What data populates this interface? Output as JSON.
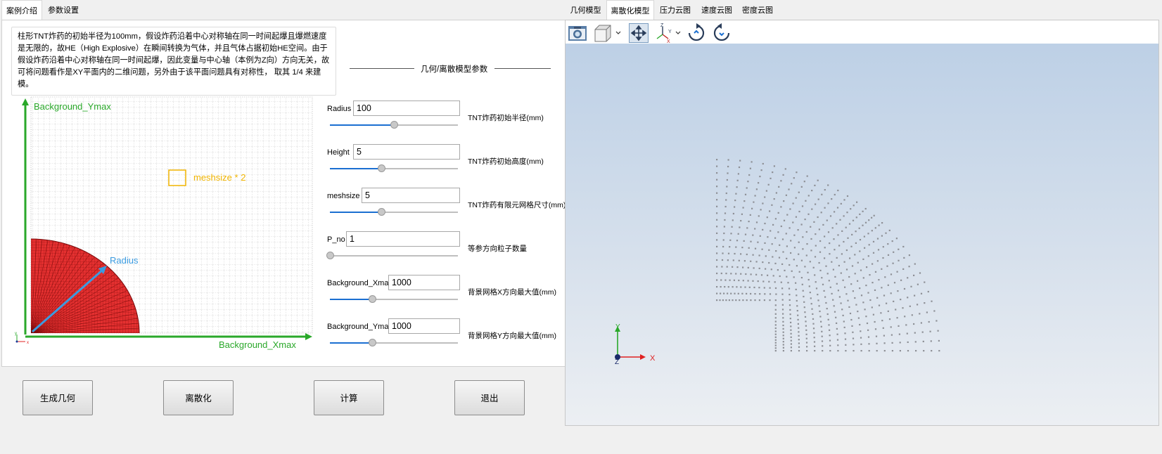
{
  "left_tabs": [
    {
      "label": "案例介绍",
      "active": true
    },
    {
      "label": "参数设置",
      "active": false
    }
  ],
  "right_tabs": [
    {
      "label": "几何模型",
      "active": false
    },
    {
      "label": "离散化模型",
      "active": true
    },
    {
      "label": "压力云图",
      "active": false
    },
    {
      "label": "速度云图",
      "active": false
    },
    {
      "label": "密度云图",
      "active": false
    }
  ],
  "description": "柱形TNT炸药的初始半径为100mm，假设炸药沿着中心对称轴在同一时间起爆且爆燃速度是无限的，故HE（High Explosive）在瞬间转换为气体，并且气体占据初始HE空间。由于假设炸药沿着中心对称轴在同一时间起爆，因此变量与中心轴（本例为Z向）方向无关，故可将问题看作是XY平面内的二维问题，另外由于该平面问题具有对称性，  取其 1/4 来建模。",
  "diagram": {
    "ymax_label": "Background_Ymax",
    "xmax_label": "Background_Xmax",
    "meshsize_label": "meshsize * 2",
    "radius_label": "Radius",
    "green": "#2aa82a",
    "blue": "#3b9be0",
    "orange": "#f0b400",
    "red": "#e02020"
  },
  "params_title": "几何/离散模型参数",
  "params": [
    {
      "label": "Radius",
      "value": "100",
      "desc": "TNT炸药初始半径(mm)",
      "slider": 0.5
    },
    {
      "label": "Height",
      "value": "5",
      "desc": "TNT炸药初始高度(mm)",
      "slider": 0.4
    },
    {
      "label": "meshsize",
      "value": "5",
      "desc": "TNT炸药有限元网格尺寸(mm)",
      "slider": 0.4
    },
    {
      "label": "P_no",
      "value": "1",
      "desc": "等参方向粒子数量",
      "slider": 0.0
    },
    {
      "label": "Background_Xmax",
      "value": "1000",
      "desc": "背景网格X方向最大值(mm)",
      "slider": 0.33
    },
    {
      "label": "Background_Ymax",
      "value": "1000",
      "desc": "背景网格Y方向最大值(mm)",
      "slider": 0.33
    }
  ],
  "buttons": [
    "生成几何",
    "离散化",
    "计算",
    "退出"
  ],
  "toolbar_icons": [
    "camera-icon",
    "view-cube-icon",
    "pan-icon",
    "axes-icon",
    "rotate-cw-icon",
    "rotate-ccw-icon"
  ],
  "axes": {
    "x": "X",
    "y": "Y",
    "z": "Z"
  }
}
